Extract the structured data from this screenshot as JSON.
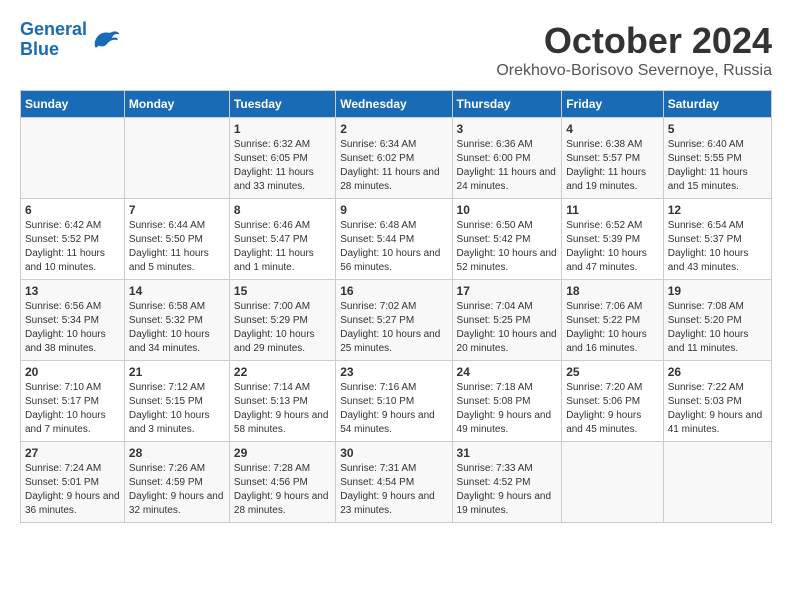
{
  "header": {
    "logo_line1": "General",
    "logo_line2": "Blue",
    "month": "October 2024",
    "location": "Orekhovo-Borisovo Severnoye, Russia"
  },
  "days_of_week": [
    "Sunday",
    "Monday",
    "Tuesday",
    "Wednesday",
    "Thursday",
    "Friday",
    "Saturday"
  ],
  "weeks": [
    [
      {
        "day": "",
        "info": ""
      },
      {
        "day": "",
        "info": ""
      },
      {
        "day": "1",
        "info": "Sunrise: 6:32 AM\nSunset: 6:05 PM\nDaylight: 11 hours and 33 minutes."
      },
      {
        "day": "2",
        "info": "Sunrise: 6:34 AM\nSunset: 6:02 PM\nDaylight: 11 hours and 28 minutes."
      },
      {
        "day": "3",
        "info": "Sunrise: 6:36 AM\nSunset: 6:00 PM\nDaylight: 11 hours and 24 minutes."
      },
      {
        "day": "4",
        "info": "Sunrise: 6:38 AM\nSunset: 5:57 PM\nDaylight: 11 hours and 19 minutes."
      },
      {
        "day": "5",
        "info": "Sunrise: 6:40 AM\nSunset: 5:55 PM\nDaylight: 11 hours and 15 minutes."
      }
    ],
    [
      {
        "day": "6",
        "info": "Sunrise: 6:42 AM\nSunset: 5:52 PM\nDaylight: 11 hours and 10 minutes."
      },
      {
        "day": "7",
        "info": "Sunrise: 6:44 AM\nSunset: 5:50 PM\nDaylight: 11 hours and 5 minutes."
      },
      {
        "day": "8",
        "info": "Sunrise: 6:46 AM\nSunset: 5:47 PM\nDaylight: 11 hours and 1 minute."
      },
      {
        "day": "9",
        "info": "Sunrise: 6:48 AM\nSunset: 5:44 PM\nDaylight: 10 hours and 56 minutes."
      },
      {
        "day": "10",
        "info": "Sunrise: 6:50 AM\nSunset: 5:42 PM\nDaylight: 10 hours and 52 minutes."
      },
      {
        "day": "11",
        "info": "Sunrise: 6:52 AM\nSunset: 5:39 PM\nDaylight: 10 hours and 47 minutes."
      },
      {
        "day": "12",
        "info": "Sunrise: 6:54 AM\nSunset: 5:37 PM\nDaylight: 10 hours and 43 minutes."
      }
    ],
    [
      {
        "day": "13",
        "info": "Sunrise: 6:56 AM\nSunset: 5:34 PM\nDaylight: 10 hours and 38 minutes."
      },
      {
        "day": "14",
        "info": "Sunrise: 6:58 AM\nSunset: 5:32 PM\nDaylight: 10 hours and 34 minutes."
      },
      {
        "day": "15",
        "info": "Sunrise: 7:00 AM\nSunset: 5:29 PM\nDaylight: 10 hours and 29 minutes."
      },
      {
        "day": "16",
        "info": "Sunrise: 7:02 AM\nSunset: 5:27 PM\nDaylight: 10 hours and 25 minutes."
      },
      {
        "day": "17",
        "info": "Sunrise: 7:04 AM\nSunset: 5:25 PM\nDaylight: 10 hours and 20 minutes."
      },
      {
        "day": "18",
        "info": "Sunrise: 7:06 AM\nSunset: 5:22 PM\nDaylight: 10 hours and 16 minutes."
      },
      {
        "day": "19",
        "info": "Sunrise: 7:08 AM\nSunset: 5:20 PM\nDaylight: 10 hours and 11 minutes."
      }
    ],
    [
      {
        "day": "20",
        "info": "Sunrise: 7:10 AM\nSunset: 5:17 PM\nDaylight: 10 hours and 7 minutes."
      },
      {
        "day": "21",
        "info": "Sunrise: 7:12 AM\nSunset: 5:15 PM\nDaylight: 10 hours and 3 minutes."
      },
      {
        "day": "22",
        "info": "Sunrise: 7:14 AM\nSunset: 5:13 PM\nDaylight: 9 hours and 58 minutes."
      },
      {
        "day": "23",
        "info": "Sunrise: 7:16 AM\nSunset: 5:10 PM\nDaylight: 9 hours and 54 minutes."
      },
      {
        "day": "24",
        "info": "Sunrise: 7:18 AM\nSunset: 5:08 PM\nDaylight: 9 hours and 49 minutes."
      },
      {
        "day": "25",
        "info": "Sunrise: 7:20 AM\nSunset: 5:06 PM\nDaylight: 9 hours and 45 minutes."
      },
      {
        "day": "26",
        "info": "Sunrise: 7:22 AM\nSunset: 5:03 PM\nDaylight: 9 hours and 41 minutes."
      }
    ],
    [
      {
        "day": "27",
        "info": "Sunrise: 7:24 AM\nSunset: 5:01 PM\nDaylight: 9 hours and 36 minutes."
      },
      {
        "day": "28",
        "info": "Sunrise: 7:26 AM\nSunset: 4:59 PM\nDaylight: 9 hours and 32 minutes."
      },
      {
        "day": "29",
        "info": "Sunrise: 7:28 AM\nSunset: 4:56 PM\nDaylight: 9 hours and 28 minutes."
      },
      {
        "day": "30",
        "info": "Sunrise: 7:31 AM\nSunset: 4:54 PM\nDaylight: 9 hours and 23 minutes."
      },
      {
        "day": "31",
        "info": "Sunrise: 7:33 AM\nSunset: 4:52 PM\nDaylight: 9 hours and 19 minutes."
      },
      {
        "day": "",
        "info": ""
      },
      {
        "day": "",
        "info": ""
      }
    ]
  ]
}
